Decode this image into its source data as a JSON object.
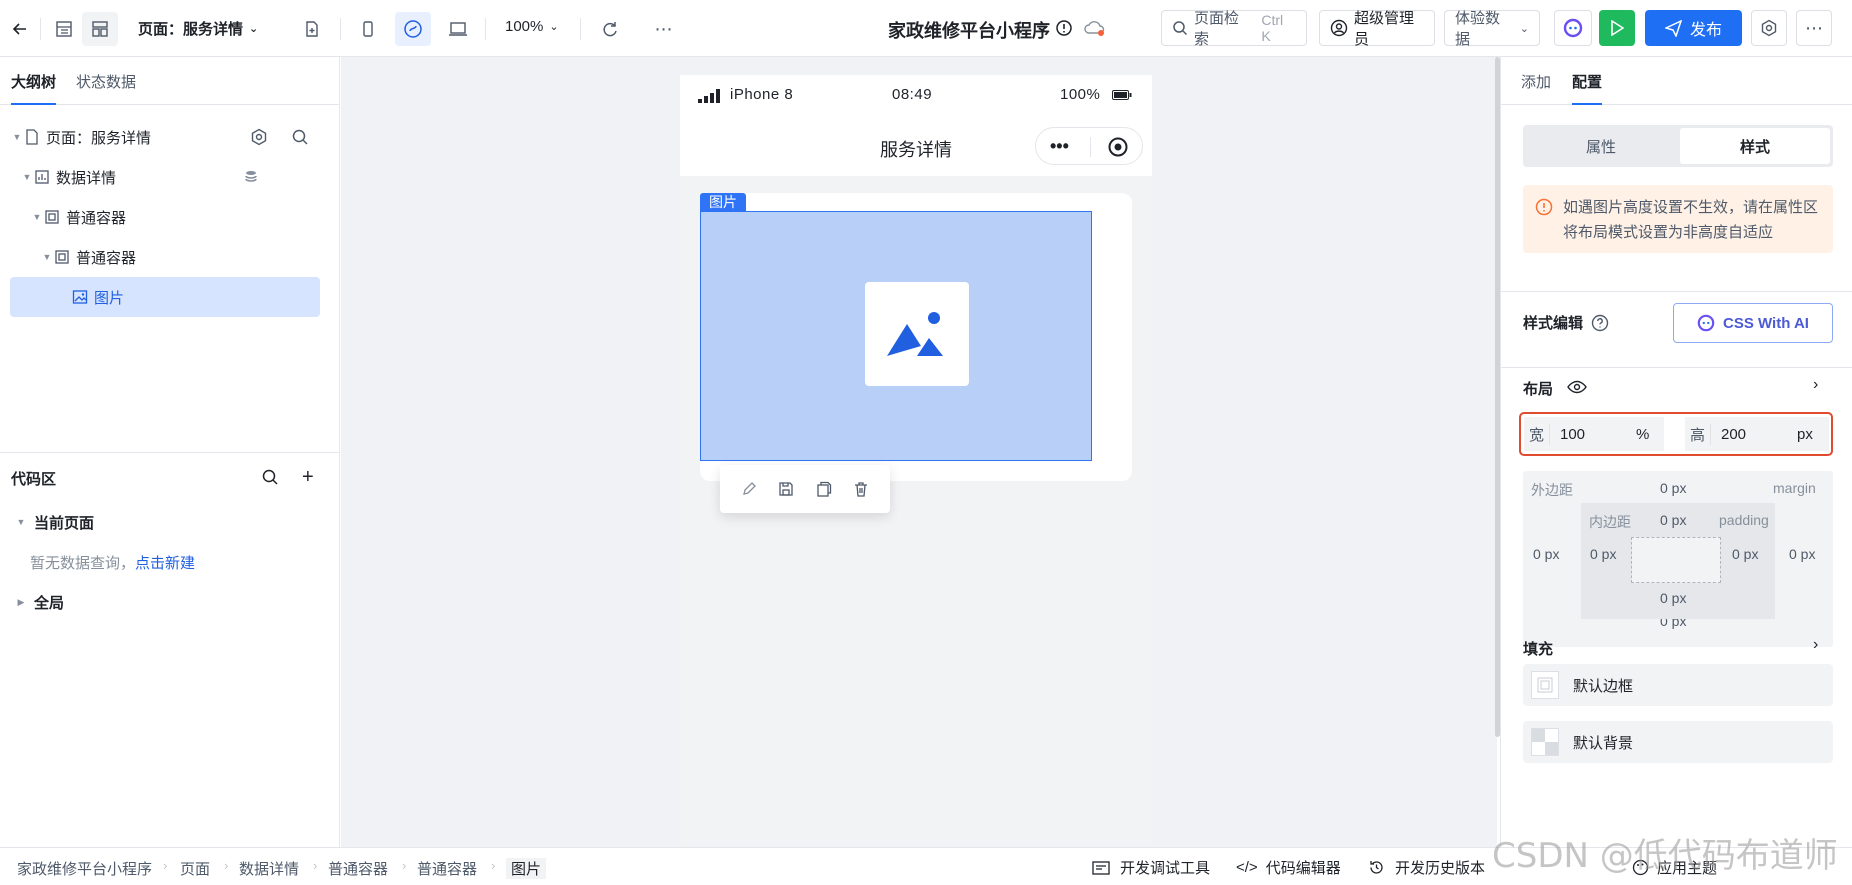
{
  "topbar": {
    "page_selector": "页面：服务详情",
    "zoom": "100%",
    "app_title": "家政维修平台小程序",
    "search_placeholder": "页面检索",
    "search_shortcut": "Ctrl K",
    "user_role": "超级管理员",
    "data_env": "体验数据",
    "publish_label": "发布"
  },
  "left": {
    "tabs": [
      "大纲树",
      "状态数据"
    ],
    "tree": [
      {
        "label": "页面：服务详情"
      },
      {
        "label": "数据详情"
      },
      {
        "label": "普通容器"
      },
      {
        "label": "普通容器"
      },
      {
        "label": "图片"
      }
    ],
    "code_title": "代码区",
    "current_page": "当前页面",
    "empty_hint": "暂无数据查询，",
    "empty_link": "点击新建",
    "global": "全局"
  },
  "phone": {
    "device": "iPhone 8",
    "time": "08:49",
    "battery": "100%",
    "page_title": "服务详情",
    "image_tag": "图片"
  },
  "right": {
    "tabs": [
      "添加",
      "配置"
    ],
    "seg": [
      "属性",
      "样式"
    ],
    "notice": "如遇图片高度设置不生效，请在属性区将布局模式设置为非高度自适应",
    "style_edit": "样式编辑",
    "ai_button": "CSS With AI",
    "layout_title": "布局",
    "width_label": "宽",
    "width_value": "100",
    "width_unit": "%",
    "height_label": "高",
    "height_value": "200",
    "height_unit": "px",
    "margin_label": "外边距",
    "margin_en": "margin",
    "padding_label": "内边距",
    "padding_en": "padding",
    "zero_px": "0 px",
    "fill_title": "填充",
    "default_border": "默认边框",
    "default_bg": "默认背景"
  },
  "statusbar": {
    "breadcrumbs": [
      "家政维修平台小程序",
      "页面",
      "数据详情",
      "普通容器",
      "普通容器",
      "图片"
    ],
    "debug_tools": "开发调试工具",
    "code_editor": "代码编辑器",
    "history": "开发历史版本",
    "theme": "应用主题"
  },
  "watermark": "CSDN @低代码布道师",
  "colors": {
    "accent": "#1f6ff5",
    "run": "#1fb95e",
    "selected_bg": "#d6e4ff",
    "notice_bg": "#fff1e6",
    "highlight_border": "#e14b30"
  }
}
